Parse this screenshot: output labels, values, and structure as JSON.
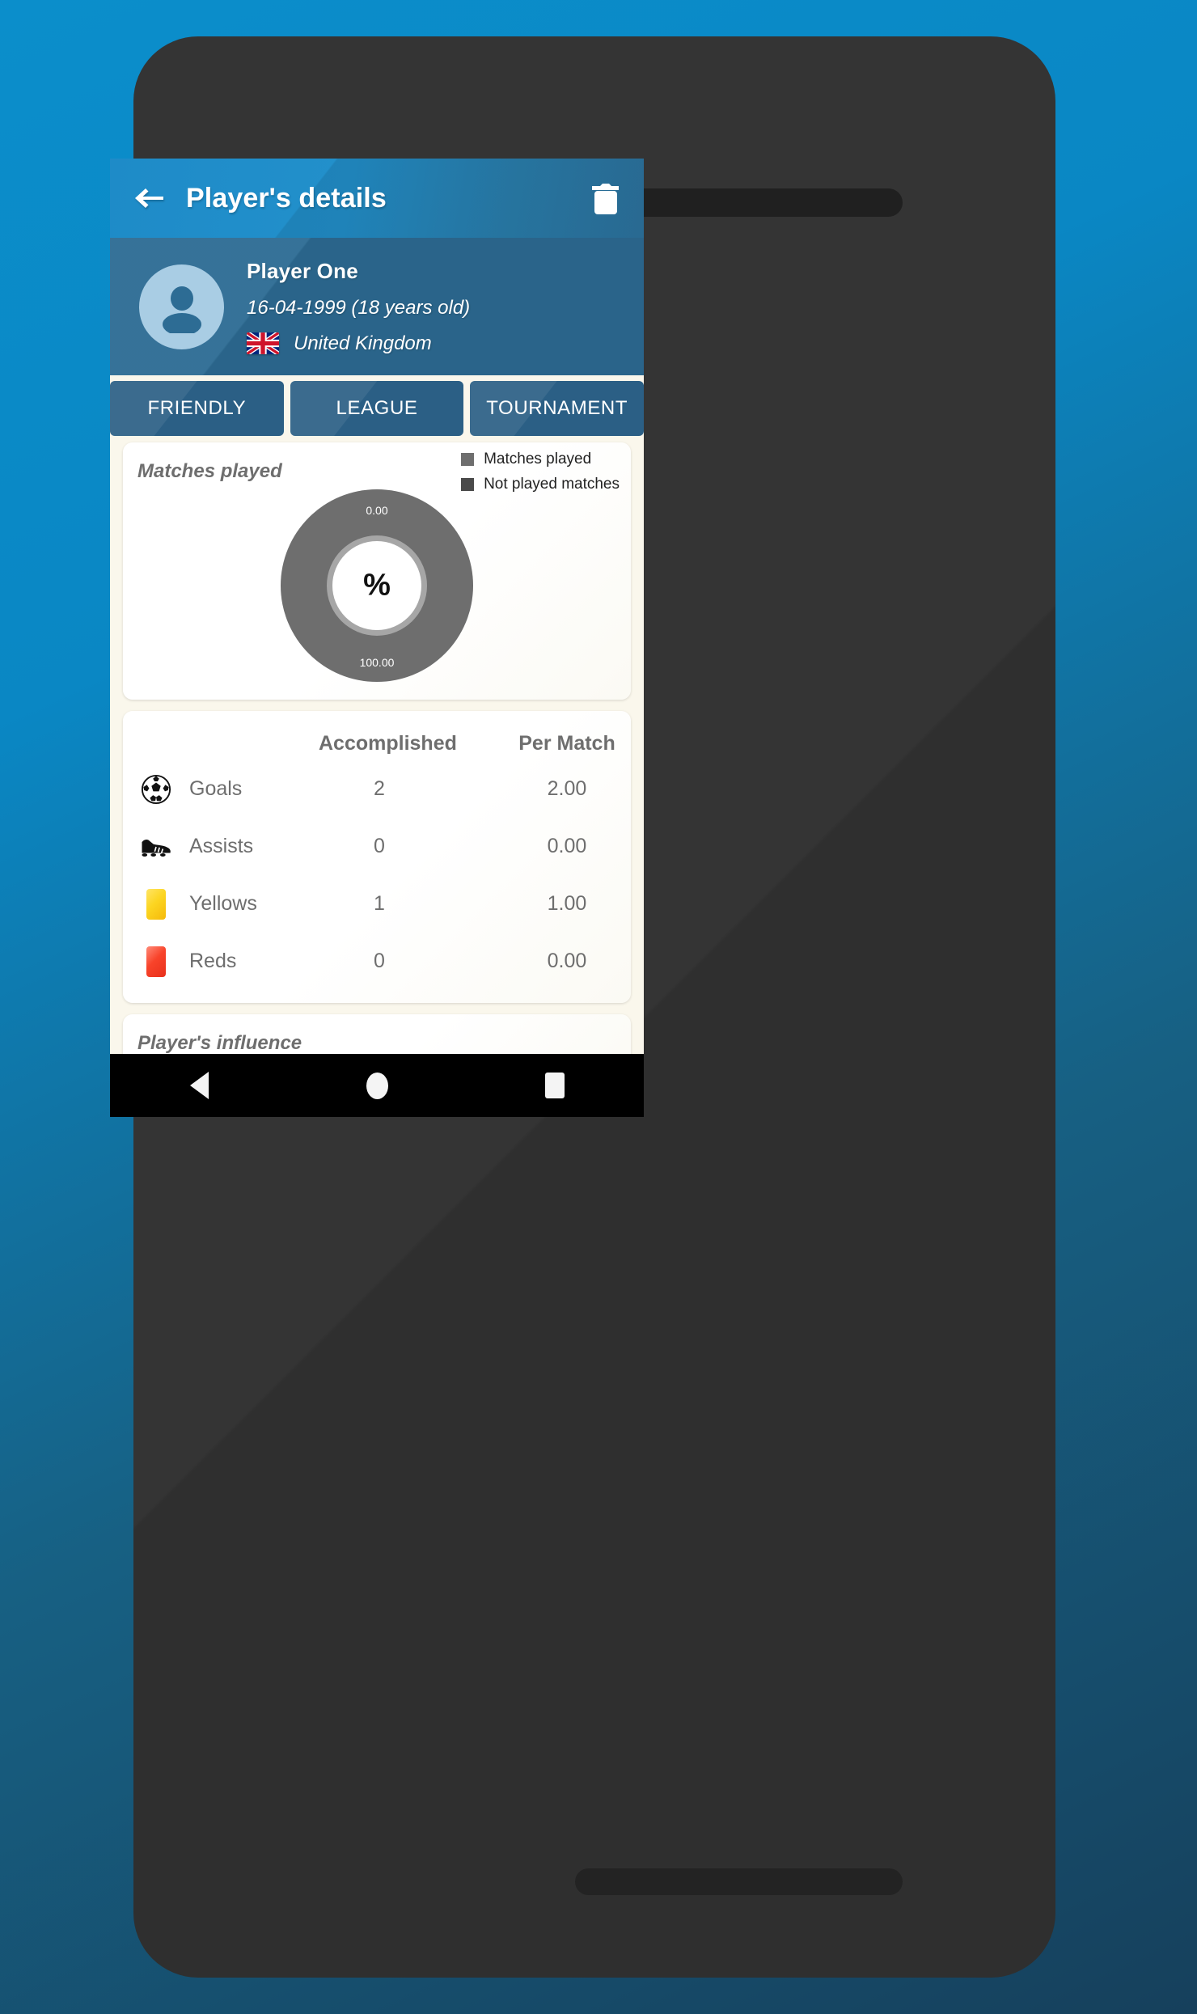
{
  "app_bar": {
    "title": "Player's details",
    "back_icon": "arrow-left-icon",
    "delete_icon": "trash-icon"
  },
  "player": {
    "name": "Player One",
    "birth_date": "16-04-1999 (18 years old)",
    "country": "United Kingdom",
    "flag": "uk-flag-icon",
    "avatar_icon": "person-avatar-icon"
  },
  "tabs": [
    {
      "label": "FRIENDLY",
      "selected": true
    },
    {
      "label": "LEAGUE",
      "selected": false
    },
    {
      "label": "TOURNAMENT",
      "selected": false
    }
  ],
  "matches_card": {
    "title": "Matches played",
    "center_text": "%"
  },
  "chart_data": {
    "type": "pie",
    "title": "Matches played",
    "labels": [
      "Matches played",
      "Not played matches"
    ],
    "values": [
      0.0,
      100.0
    ],
    "value_labels": [
      "0.00",
      "100.00"
    ],
    "colors": [
      "#6e6e6e",
      "#4a4a4a"
    ],
    "legend_position": "right",
    "donut": true,
    "center_label": "%"
  },
  "stats_card": {
    "headers": {
      "icon": "",
      "name": "",
      "accomplished": "Accomplished",
      "per_match": "Per Match"
    },
    "rows": [
      {
        "icon": "soccer-ball-icon",
        "name": "Goals",
        "accomplished": "2",
        "per_match": "2.00"
      },
      {
        "icon": "soccer-boot-icon",
        "name": "Assists",
        "accomplished": "0",
        "per_match": "0.00"
      },
      {
        "icon": "yellow-card-icon",
        "name": "Yellows",
        "accomplished": "1",
        "per_match": "1.00"
      },
      {
        "icon": "red-card-icon",
        "name": "Reds",
        "accomplished": "0",
        "per_match": "0.00"
      }
    ]
  },
  "influence_card": {
    "title": "Player's influence"
  },
  "nav_bar": {
    "back": "nav-back-icon",
    "home": "nav-home-icon",
    "recents": "nav-recents-icon"
  },
  "colors": {
    "accent": "#2290cb",
    "header_blue": "#2d6c94",
    "tab_blue": "#2b5f85",
    "screen_bg": "#faf7ec",
    "chart_light": "#6e6e6e",
    "chart_dark": "#4a4a4a",
    "yellow": "#fcd521",
    "red": "#f8432a"
  }
}
